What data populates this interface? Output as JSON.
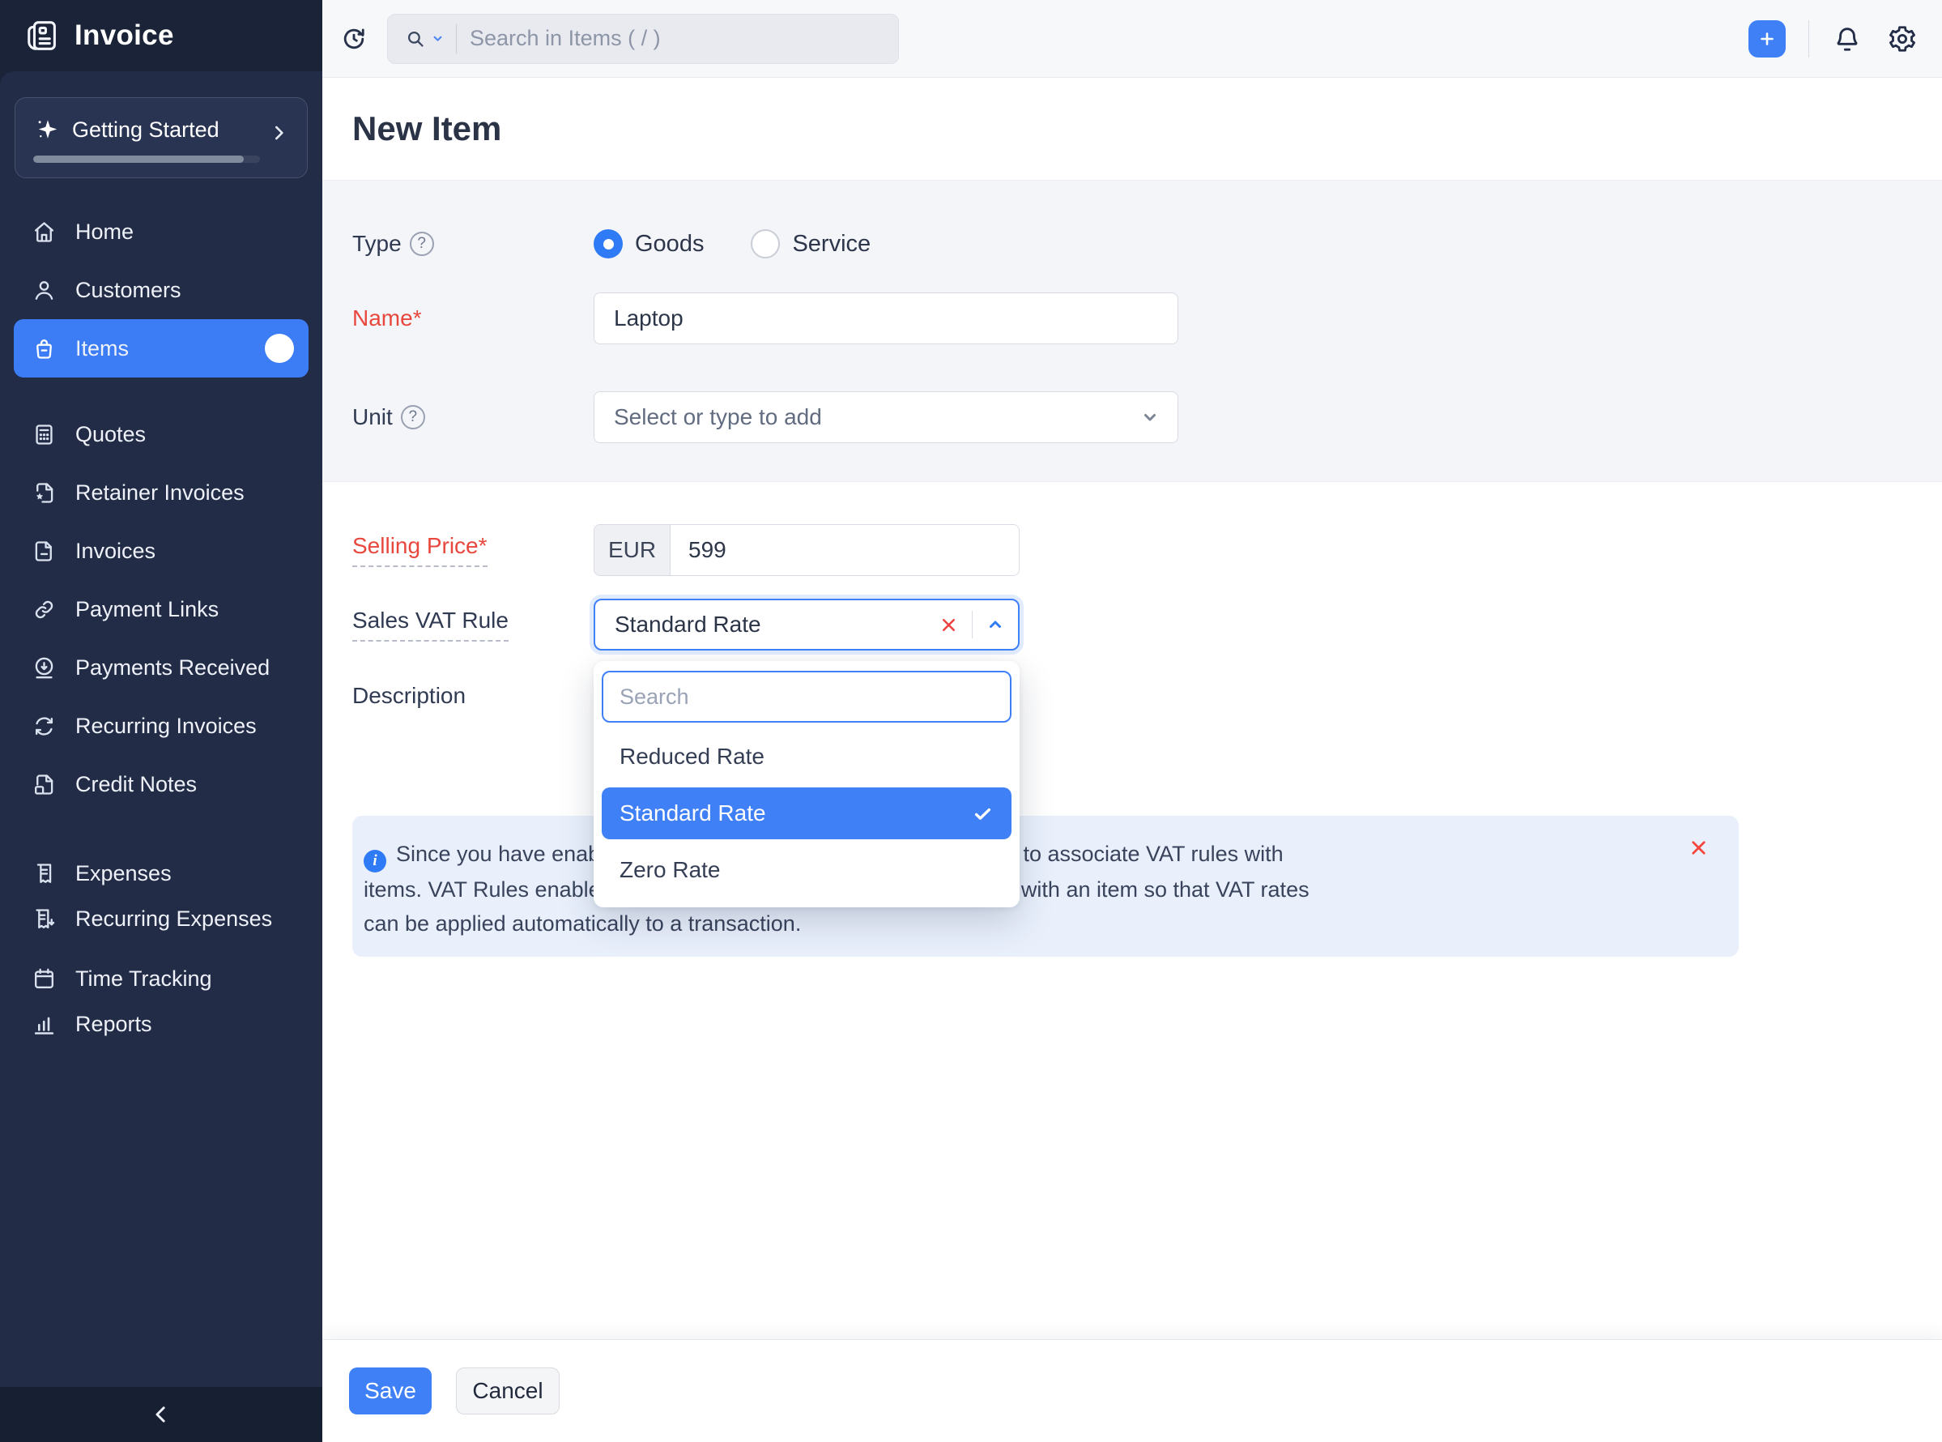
{
  "app": {
    "name": "Invoice"
  },
  "sidebar": {
    "getting_started_label": "Getting Started",
    "groups": [
      [
        "Home",
        "Customers",
        "Items"
      ],
      [
        "Quotes",
        "Retainer Invoices",
        "Invoices",
        "Payment Links",
        "Payments Received",
        "Recurring Invoices",
        "Credit Notes"
      ],
      [
        "Expenses",
        "Recurring Expenses"
      ],
      [
        "Time Tracking",
        "Reports"
      ]
    ],
    "active_item": "Items"
  },
  "topbar": {
    "search_placeholder": "Search in Items ( / )"
  },
  "page_title": "New Item",
  "form": {
    "type_label": "Type",
    "type_options": [
      "Goods",
      "Service"
    ],
    "type_selected": "Goods",
    "name_label": "Name*",
    "name_value": "Laptop",
    "unit_label": "Unit",
    "unit_placeholder": "Select or type to add",
    "selling_price_label": "Selling Price*",
    "currency": "EUR",
    "selling_price_value": "599",
    "vat_rule_label": "Sales VAT Rule",
    "vat_rule_value": "Standard Rate",
    "description_label": "Description"
  },
  "vat_dropdown": {
    "search_placeholder": "Search",
    "options": [
      "Reduced Rate",
      "Standard Rate",
      "Zero Rate"
    ],
    "selected": "Standard Rate"
  },
  "banner": {
    "lines": [
      "Since you have enabled VAT for your organisation, you will have to associate VAT rules with",
      "items. VAT Rules enable you to define a set criteria and associate it with an item so that VAT rates",
      "can be applied automatically to a transaction."
    ]
  },
  "footer": {
    "save_label": "Save",
    "cancel_label": "Cancel"
  },
  "colors": {
    "accent": "#3f80f6",
    "sidebar_bg": "#222c47",
    "danger_red": "#e8473d",
    "banner_bg": "#e9f0fc"
  }
}
